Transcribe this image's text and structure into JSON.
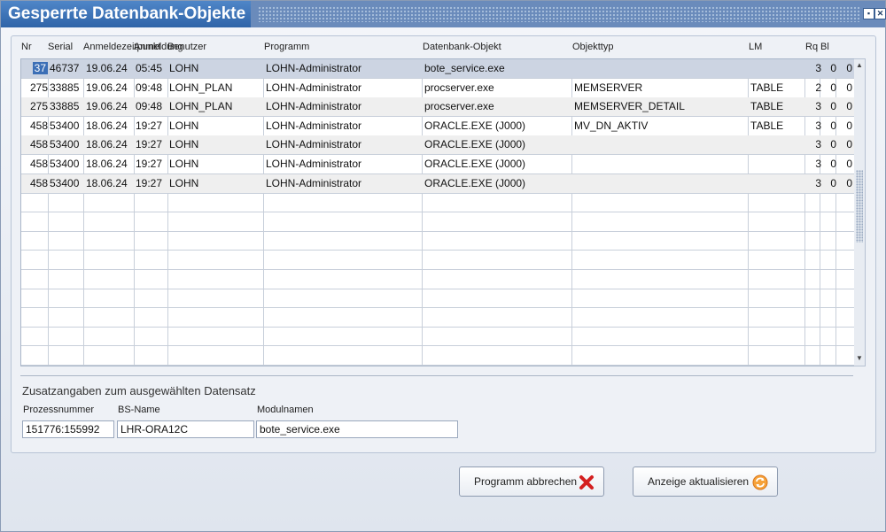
{
  "window": {
    "title": "Gesperrte Datenbank-Objekte"
  },
  "table": {
    "columns": [
      "Nr",
      "Serial",
      "Anmeldezeitpunkt",
      "Anmeldung",
      "Benutzer",
      "Programm",
      "Datenbank-Objekt",
      "Objekttyp",
      "LM",
      "Rq",
      "Bl"
    ],
    "rows": [
      {
        "nr": "37",
        "serial": "46737",
        "date": "19.06.24",
        "time": "05:45",
        "anmeldung": "LOHN",
        "benutzer": "LOHN-Administrator",
        "programm": "bote_service.exe",
        "objekt": "",
        "typ": "",
        "lm": "3",
        "rq": "0",
        "bl": "0"
      },
      {
        "nr": "275",
        "serial": "33885",
        "date": "19.06.24",
        "time": "09:48",
        "anmeldung": "LOHN_PLAN",
        "benutzer": "LOHN-Administrator",
        "programm": "procserver.exe",
        "objekt": "MEMSERVER",
        "typ": "TABLE",
        "lm": "2",
        "rq": "0",
        "bl": "0"
      },
      {
        "nr": "275",
        "serial": "33885",
        "date": "19.06.24",
        "time": "09:48",
        "anmeldung": "LOHN_PLAN",
        "benutzer": "LOHN-Administrator",
        "programm": "procserver.exe",
        "objekt": "MEMSERVER_DETAIL",
        "typ": "TABLE",
        "lm": "3",
        "rq": "0",
        "bl": "0"
      },
      {
        "nr": "458",
        "serial": "53400",
        "date": "18.06.24",
        "time": "19:27",
        "anmeldung": "LOHN",
        "benutzer": "LOHN-Administrator",
        "programm": "ORACLE.EXE (J000)",
        "objekt": "MV_DN_AKTIV",
        "typ": "TABLE",
        "lm": "3",
        "rq": "0",
        "bl": "0"
      },
      {
        "nr": "458",
        "serial": "53400",
        "date": "18.06.24",
        "time": "19:27",
        "anmeldung": "LOHN",
        "benutzer": "LOHN-Administrator",
        "programm": "ORACLE.EXE (J000)",
        "objekt": "",
        "typ": "",
        "lm": "3",
        "rq": "0",
        "bl": "0"
      },
      {
        "nr": "458",
        "serial": "53400",
        "date": "18.06.24",
        "time": "19:27",
        "anmeldung": "LOHN",
        "benutzer": "LOHN-Administrator",
        "programm": "ORACLE.EXE (J000)",
        "objekt": "",
        "typ": "",
        "lm": "3",
        "rq": "0",
        "bl": "0"
      },
      {
        "nr": "458",
        "serial": "53400",
        "date": "18.06.24",
        "time": "19:27",
        "anmeldung": "LOHN",
        "benutzer": "LOHN-Administrator",
        "programm": "ORACLE.EXE (J000)",
        "objekt": "",
        "typ": "",
        "lm": "3",
        "rq": "0",
        "bl": "0"
      }
    ]
  },
  "details": {
    "title": "Zusatzangaben zum ausgewählten Datensatz",
    "prozessnummer_label": "Prozessnummer",
    "prozessnummer_value": "151776:155992",
    "bsname_label": "BS-Name",
    "bsname_value": "LHR-ORA12C",
    "modulnamen_label": "Modulnamen",
    "modulnamen_value": "bote_service.exe"
  },
  "buttons": {
    "abbrechen": "Programm abbrechen",
    "aktualisieren": "Anzeige aktualisieren"
  },
  "icons": {
    "abbrechen": "red-x-icon",
    "aktualisieren": "refresh-icon"
  },
  "colors": {
    "title_bg": "#2f64a8",
    "selection": "#3c6fb6",
    "cancel_icon": "#d42020",
    "refresh_icon": "#f08a1c"
  }
}
